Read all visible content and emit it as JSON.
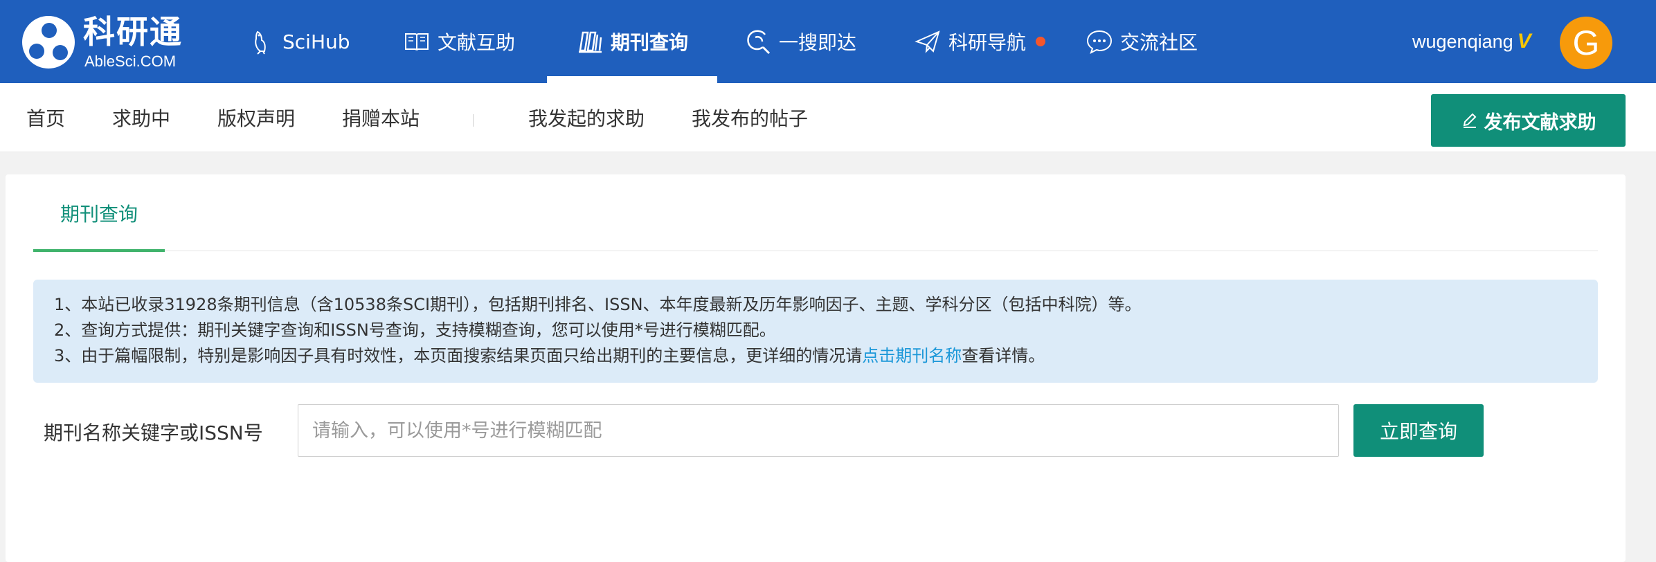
{
  "app": {
    "title": "科研通",
    "subtitle": "AbleSci.COM"
  },
  "topnav": {
    "items": [
      {
        "label": "SciHub",
        "icon": "bird-icon"
      },
      {
        "label": "文献互助",
        "icon": "book-icon"
      },
      {
        "label": "期刊查询",
        "icon": "journals-icon",
        "active": true
      },
      {
        "label": "一搜即达",
        "icon": "search-swirl-icon"
      },
      {
        "label": "科研导航",
        "icon": "paper-plane-icon",
        "badge_dot": true
      },
      {
        "label": "交流社区",
        "icon": "chat-bubble-icon"
      }
    ],
    "username": "wugenqiang",
    "vip_mark": "V",
    "avatar_letter": "G"
  },
  "subnav": {
    "items": [
      "首页",
      "求助中",
      "版权声明",
      "捐赠本站",
      "我发起的求助",
      "我发布的帖子"
    ],
    "post_button": "发布文献求助"
  },
  "tabs": {
    "active": "期刊查询"
  },
  "notice": {
    "line1": "1、本站已收录31928条期刊信息（含10538条SCI期刊），包括期刊排名、ISSN、本年度最新及历年影响因子、主题、学科分区（包括中科院）等。",
    "line2": "2、查询方式提供：期刊关键字查询和ISSN号查询，支持模糊查询，您可以使用*号进行模糊匹配。",
    "line3_prefix": "3、由于篇幅限制，特别是影响因子具有时效性，本页面搜索结果页面只给出期刊的主要信息，更详细的情况请",
    "line3_link": "点击期刊名称",
    "line3_suffix": "查看详情。"
  },
  "search": {
    "label": "期刊名称关键字或ISSN号",
    "value": "",
    "placeholder": "请输入，可以使用*号进行模糊匹配",
    "button": "立即查询"
  },
  "colors": {
    "topbar": "#1f5fbd",
    "accent_green": "#108f79",
    "notice_bg": "#dcebf8",
    "link": "#1a97d8",
    "avatar": "#f79a0b",
    "vip": "#f7c600",
    "dot": "#f5562b"
  }
}
